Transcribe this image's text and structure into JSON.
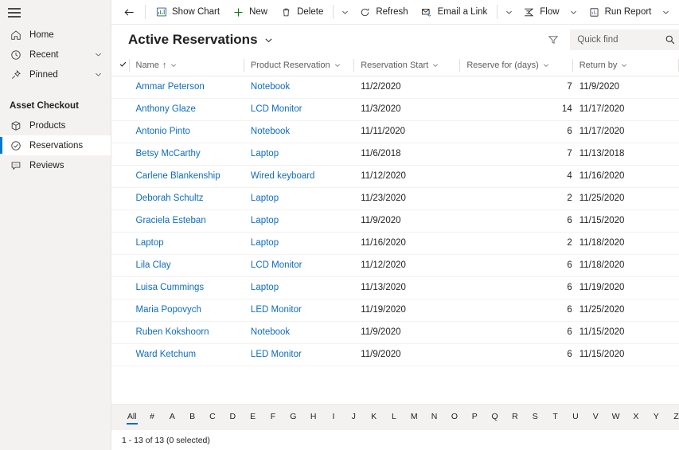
{
  "sidebar": {
    "menu_icon": "hamburger-icon",
    "items": [
      {
        "label": "Home",
        "icon": "home-icon",
        "has_chevron": false,
        "selected": false
      },
      {
        "label": "Recent",
        "icon": "clock-icon",
        "has_chevron": true,
        "selected": false
      },
      {
        "label": "Pinned",
        "icon": "pin-icon",
        "has_chevron": true,
        "selected": false
      }
    ],
    "group_header": "Asset Checkout",
    "group_items": [
      {
        "label": "Products",
        "icon": "box-icon",
        "selected": false
      },
      {
        "label": "Reservations",
        "icon": "check-circle-icon",
        "selected": true
      },
      {
        "label": "Reviews",
        "icon": "comment-icon",
        "selected": false
      }
    ],
    "accent_color": "#0078d4",
    "background": "#f3f2f1"
  },
  "commandbar": {
    "back_icon": "back-arrow-icon",
    "buttons": [
      {
        "label": "Show Chart",
        "icon": "chart-icon",
        "caret": false
      },
      {
        "label": "New",
        "icon": "plus-icon",
        "caret": false
      },
      {
        "label": "Delete",
        "icon": "trash-icon",
        "caret": true
      },
      {
        "label": "Refresh",
        "icon": "refresh-icon",
        "caret": false
      },
      {
        "label": "Email a Link",
        "icon": "email-icon",
        "caret": true
      },
      {
        "label": "Flow",
        "icon": "flow-icon",
        "caret": true
      },
      {
        "label": "Run Report",
        "icon": "report-icon",
        "caret": true
      }
    ],
    "overflow_icon": "more-vertical-icon",
    "overflow_label": "⋮"
  },
  "header": {
    "view_title": "Active Reservations",
    "view_caret_icon": "chevron-down-icon",
    "filter_icon": "filter-icon",
    "search": {
      "placeholder": "Quick find",
      "value": "",
      "icon": "search-icon"
    }
  },
  "grid": {
    "select_all_icon": "checkmark-icon",
    "columns": [
      {
        "label": "Name",
        "sorted": true,
        "sort_dir": "↑",
        "align": "left"
      },
      {
        "label": "Product Reservation",
        "sorted": false,
        "sort_dir": "",
        "align": "left"
      },
      {
        "label": "Reservation Start",
        "sorted": false,
        "sort_dir": "",
        "align": "left"
      },
      {
        "label": "Reserve for (days)",
        "sorted": false,
        "sort_dir": "",
        "align": "right"
      },
      {
        "label": "Return by",
        "sorted": false,
        "sort_dir": "",
        "align": "left"
      }
    ],
    "rows": [
      {
        "name": "Ammar Peterson",
        "product": "Notebook",
        "start": "11/2/2020",
        "days": "7",
        "return": "11/9/2020"
      },
      {
        "name": "Anthony Glaze",
        "product": "LCD Monitor",
        "start": "11/3/2020",
        "days": "14",
        "return": "11/17/2020"
      },
      {
        "name": "Antonio Pinto",
        "product": "Notebook",
        "start": "11/11/2020",
        "days": "6",
        "return": "11/17/2020"
      },
      {
        "name": "Betsy McCarthy",
        "product": "Laptop",
        "start": "11/6/2018",
        "days": "7",
        "return": "11/13/2018"
      },
      {
        "name": "Carlene Blankenship",
        "product": "Wired keyboard",
        "start": "11/12/2020",
        "days": "4",
        "return": "11/16/2020"
      },
      {
        "name": "Deborah Schultz",
        "product": "Laptop",
        "start": "11/23/2020",
        "days": "2",
        "return": "11/25/2020"
      },
      {
        "name": "Graciela Esteban",
        "product": "Laptop",
        "start": "11/9/2020",
        "days": "6",
        "return": "11/15/2020"
      },
      {
        "name": "Laptop",
        "product": "Laptop",
        "start": "11/16/2020",
        "days": "2",
        "return": "11/18/2020"
      },
      {
        "name": "Lila Clay",
        "product": "LCD Monitor",
        "start": "11/12/2020",
        "days": "6",
        "return": "11/18/2020"
      },
      {
        "name": "Luisa Cummings",
        "product": "Laptop",
        "start": "11/13/2020",
        "days": "6",
        "return": "11/19/2020"
      },
      {
        "name": "Maria Popovych",
        "product": "LED Monitor",
        "start": "11/19/2020",
        "days": "6",
        "return": "11/25/2020"
      },
      {
        "name": "Ruben Kokshoorn",
        "product": "Notebook",
        "start": "11/9/2020",
        "days": "6",
        "return": "11/15/2020"
      },
      {
        "name": "Ward Ketchum",
        "product": "LED Monitor",
        "start": "11/9/2020",
        "days": "6",
        "return": "11/15/2020"
      }
    ],
    "link_color": "#0f6cbd"
  },
  "alphabar": {
    "active": "All",
    "items": [
      "All",
      "#",
      "A",
      "B",
      "C",
      "D",
      "E",
      "F",
      "G",
      "H",
      "I",
      "J",
      "K",
      "L",
      "M",
      "N",
      "O",
      "P",
      "Q",
      "R",
      "S",
      "T",
      "U",
      "V",
      "W",
      "X",
      "Y",
      "Z"
    ]
  },
  "footer": {
    "status": "1 - 13 of 13 (0 selected)"
  }
}
